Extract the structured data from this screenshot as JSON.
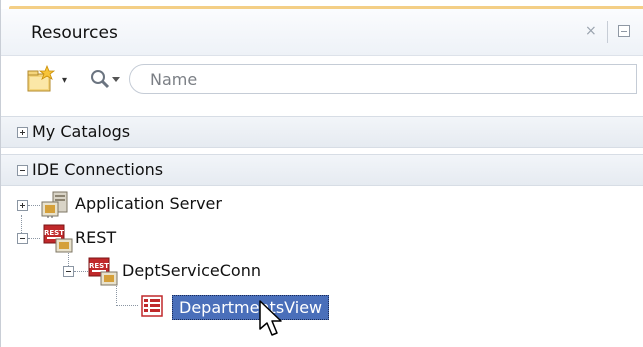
{
  "panel": {
    "title": "Resources",
    "close_glyph": "×",
    "maximize_glyph": "minimize-panel-icon"
  },
  "toolbar": {
    "new_button_icon": "new-folder-star-icon",
    "new_dropdown_glyph": "▾",
    "search_icon": "search-magnifier-icon",
    "search_dropdown_glyph": "▾",
    "search_placeholder": "Name"
  },
  "sections": [
    {
      "label": "My Catalogs",
      "expanded": false
    },
    {
      "label": "IDE Connections",
      "expanded": true
    }
  ],
  "tree": {
    "items": [
      {
        "label": "Application Server",
        "icon": "app-server-icon",
        "expanded": false
      },
      {
        "label": "REST",
        "icon": "rest-icon",
        "expanded": true
      },
      {
        "label": "DeptServiceConn",
        "icon": "rest-connection-icon",
        "expanded": true
      },
      {
        "label": "DepartmentsView",
        "icon": "view-table-icon",
        "selected": true
      }
    ],
    "rest_badge_text": "REST"
  },
  "colors": {
    "accent": "#f4cf86",
    "selection": "#4a6fba"
  }
}
